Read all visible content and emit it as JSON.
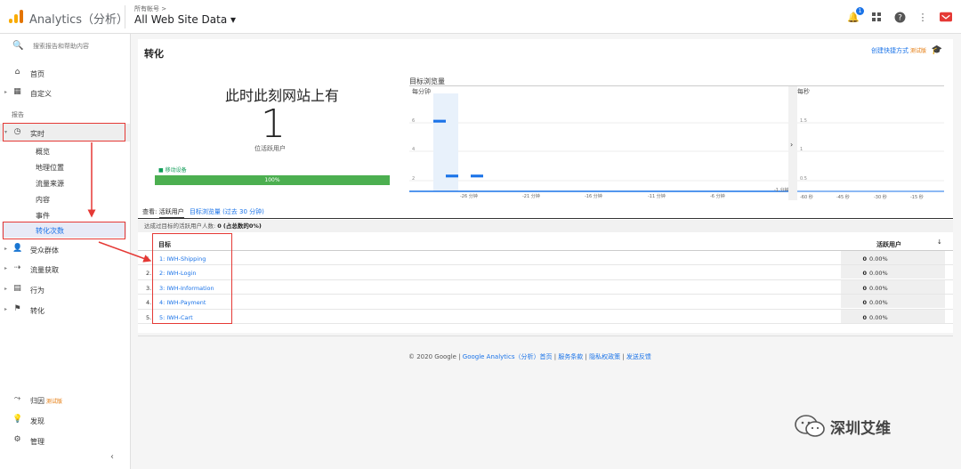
{
  "app": {
    "title": "Analytics（分析）",
    "account_path": "所有帐号 >",
    "property": "All Web Site Data ▾"
  },
  "topbar": {
    "notification_count": "1"
  },
  "sidebar": {
    "search_placeholder": "搜索报告和帮助内容",
    "home": "首页",
    "custom": "自定义",
    "reports_label": "报告",
    "realtime": "实时",
    "realtime_sub": [
      "概览",
      "地理位置",
      "流量来源",
      "内容",
      "事件",
      "转化次数"
    ],
    "audience": "受众群体",
    "acquisition": "流量获取",
    "behavior": "行为",
    "conversions": "转化",
    "attribution": "归因",
    "attribution_beta": "测试版",
    "discover": "发现",
    "admin": "管理"
  },
  "main": {
    "title": "转化",
    "shortcut": "创建快捷方式",
    "shortcut_beta": "测试版",
    "now_text": "此时此刻网站上有",
    "active_count": "1",
    "active_label": "位活跃用户",
    "device_label": "■ 移动设备",
    "device_pct": "100%",
    "chart_title": "目标浏览量",
    "per_minute": "每分钟",
    "per_second": "每秒",
    "view_label": "查看:",
    "tab_active": "活跃用户",
    "tab_goal": "目标浏览量",
    "tab_range": "(过去 30 分钟)",
    "summary_prefix": "达成过目标的活跃用户人数:",
    "summary_count": "0",
    "summary_pct": "(占总数的0%)",
    "col_goal": "目标",
    "col_active": "活跃用户",
    "sort_icon": "↓",
    "rows": [
      {
        "n": "1.",
        "goal": "1: IWH-Shipping",
        "v": "0",
        "pct": "0.00%"
      },
      {
        "n": "2.",
        "goal": "2: IWH-Login",
        "v": "0",
        "pct": "0.00%"
      },
      {
        "n": "3.",
        "goal": "3: IWH-Information",
        "v": "0",
        "pct": "0.00%"
      },
      {
        "n": "4.",
        "goal": "4: IWH-Payment",
        "v": "0",
        "pct": "0.00%"
      },
      {
        "n": "5.",
        "goal": "5: IWH-Cart",
        "v": "0",
        "pct": "0.00%"
      }
    ]
  },
  "chart_data": [
    {
      "type": "bar",
      "title": "每分钟",
      "categories": [
        "-30",
        "-29",
        "-28",
        "-27",
        "-26",
        "-25"
      ],
      "values": [
        4.3,
        1,
        0,
        1,
        0,
        0
      ],
      "yticks": [
        "6",
        "4",
        "2"
      ],
      "xticks": [
        "-26 分钟",
        "-21 分钟",
        "-16 分钟",
        "-11 分钟",
        "-6 分钟",
        "-1 分钟"
      ],
      "ylim": [
        0,
        6
      ]
    },
    {
      "type": "bar",
      "title": "每秒",
      "yticks": [
        "1.5",
        "1",
        "0.5"
      ],
      "xticks": [
        "-60 秒",
        "-45 秒",
        "-30 秒",
        "-15 秒"
      ]
    }
  ],
  "footer": {
    "copyright": "© 2020 Google",
    "links": [
      "Google Analytics（分析）首页",
      "服务条款",
      "隐私权政策",
      "发送反馈"
    ]
  },
  "watermark": {
    "text": "深圳艾维"
  }
}
